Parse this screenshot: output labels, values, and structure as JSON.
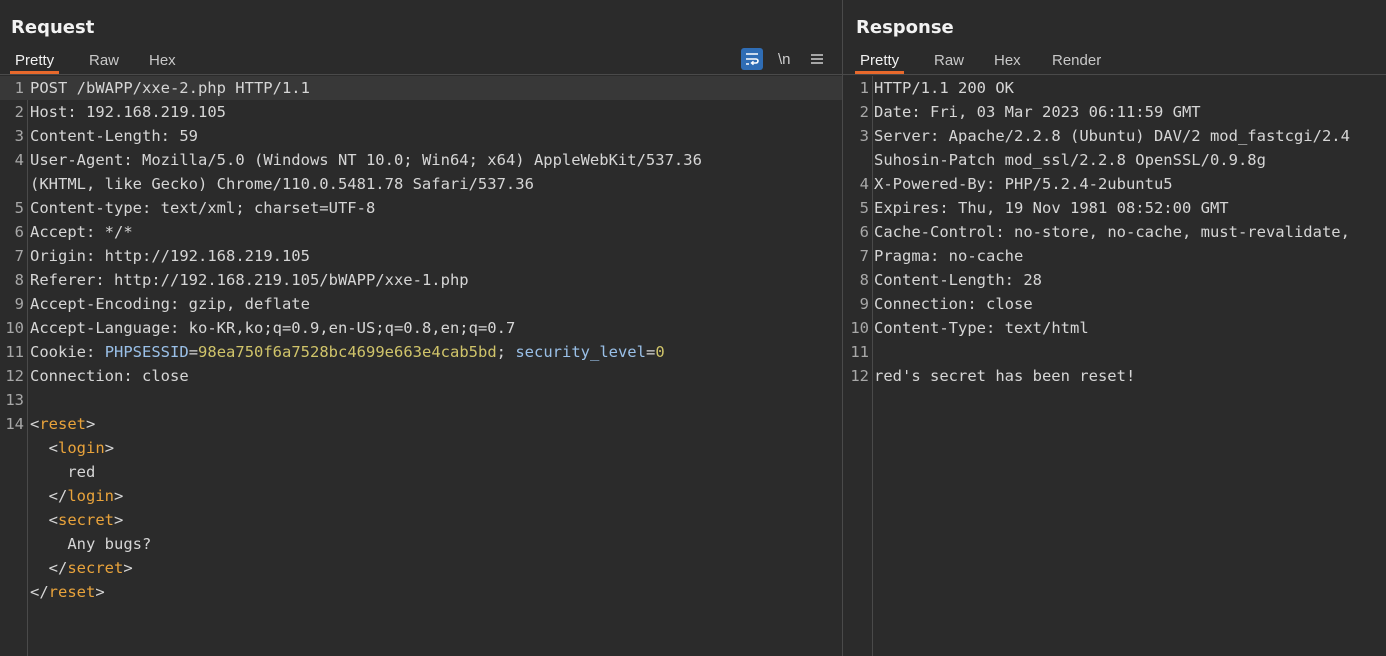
{
  "request": {
    "title": "Request",
    "tabs": [
      "Pretty",
      "Raw",
      "Hex"
    ],
    "active_tab": "Pretty",
    "tools": {
      "wrap_icon": "wrap-lines-icon",
      "newline_label": "\\n",
      "menu_icon": "hamburger-menu-icon"
    },
    "lines": [
      {
        "n": "1",
        "text": "POST /bWAPP/xxe-2.php HTTP/1.1"
      },
      {
        "n": "2",
        "key": "Host",
        "value": " 192.168.219.105"
      },
      {
        "n": "3",
        "key": "Content-Length",
        "value": " 59"
      },
      {
        "n": "4",
        "key": "User-Agent",
        "value": " Mozilla/5.0 (Windows NT 10.0; Win64; x64) AppleWebKit/537.36"
      },
      {
        "n": "",
        "text": "(KHTML, like Gecko) Chrome/110.0.5481.78 Safari/537.36"
      },
      {
        "n": "5",
        "key": "Content-type",
        "value": " text/xml; charset=UTF-8"
      },
      {
        "n": "6",
        "key": "Accept",
        "value": " */*"
      },
      {
        "n": "7",
        "key": "Origin",
        "value": " http://192.168.219.105"
      },
      {
        "n": "8",
        "key": "Referer",
        "value": " http://192.168.219.105/bWAPP/xxe-1.php"
      },
      {
        "n": "9",
        "key": "Accept-Encoding",
        "value": " gzip, deflate"
      },
      {
        "n": "10",
        "key": "Accept-Language",
        "value": " ko-KR,ko;q=0.9,en-US;q=0.8,en;q=0.7"
      },
      {
        "n": "11",
        "key": "Cookie",
        "cookie": [
          {
            "name": "PHPSESSID",
            "value": "98ea750f6a7528bc4699e663e4cab5bd"
          },
          {
            "name": "security_level",
            "value": "0"
          }
        ]
      },
      {
        "n": "12",
        "key": "Connection",
        "value": " close"
      },
      {
        "n": "13",
        "text": ""
      },
      {
        "n": "14",
        "xml": {
          "indent": "",
          "open": "reset"
        }
      },
      {
        "n": "",
        "xml": {
          "indent": "  ",
          "open": "login"
        }
      },
      {
        "n": "",
        "text": "    red"
      },
      {
        "n": "",
        "xml": {
          "indent": "  ",
          "close": "login"
        }
      },
      {
        "n": "",
        "xml": {
          "indent": "  ",
          "open": "secret"
        }
      },
      {
        "n": "",
        "text": "    Any bugs?"
      },
      {
        "n": "",
        "xml": {
          "indent": "  ",
          "close": "secret"
        }
      },
      {
        "n": "",
        "xml": {
          "indent": "",
          "close": "reset"
        }
      }
    ]
  },
  "response": {
    "title": "Response",
    "tabs": [
      "Pretty",
      "Raw",
      "Hex",
      "Render"
    ],
    "active_tab": "Pretty",
    "lines": [
      {
        "n": "1",
        "text": "HTTP/1.1 200 OK"
      },
      {
        "n": "2",
        "key": "Date",
        "value": " Fri, 03 Mar 2023 06:11:59 GMT"
      },
      {
        "n": "3",
        "key": "Server",
        "value": " Apache/2.2.8 (Ubuntu) DAV/2 mod_fastcgi/2.4"
      },
      {
        "n": "",
        "text": "Suhosin-Patch mod_ssl/2.2.8 OpenSSL/0.9.8g"
      },
      {
        "n": "4",
        "key": "X-Powered-By",
        "value": " PHP/5.2.4-2ubuntu5"
      },
      {
        "n": "5",
        "key": "Expires",
        "value": " Thu, 19 Nov 1981 08:52:00 GMT"
      },
      {
        "n": "6",
        "key": "Cache-Control",
        "value": " no-store, no-cache, must-revalidate,"
      },
      {
        "n": "7",
        "key": "Pragma",
        "value": " no-cache"
      },
      {
        "n": "8",
        "key": "Content-Length",
        "value": " 28"
      },
      {
        "n": "9",
        "key": "Connection",
        "value": " close"
      },
      {
        "n": "10",
        "key": "Content-Type",
        "value": " text/html"
      },
      {
        "n": "11",
        "text": ""
      },
      {
        "n": "12",
        "text": "red's secret has been reset!"
      }
    ]
  }
}
